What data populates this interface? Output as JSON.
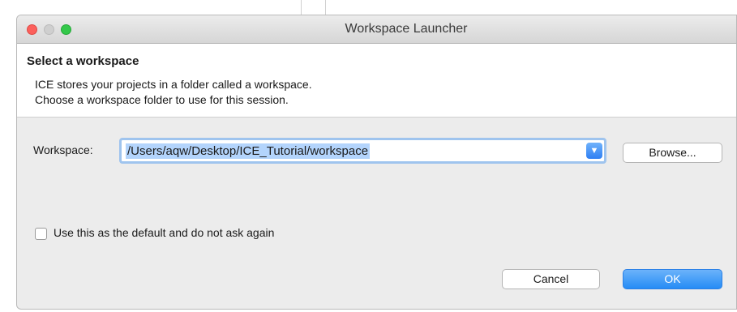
{
  "window": {
    "title": "Workspace Launcher"
  },
  "header": {
    "title": "Select a workspace",
    "description_line1": "ICE stores your projects in a folder called a workspace.",
    "description_line2": "Choose a workspace folder to use for this session."
  },
  "workspace": {
    "label": "Workspace:",
    "value": "/Users/aqw/Desktop/ICE_Tutorial/workspace",
    "browse_label": "Browse..."
  },
  "default_option": {
    "label": "Use this as the default and do not ask again",
    "checked": false
  },
  "buttons": {
    "cancel_label": "Cancel",
    "ok_label": "OK"
  },
  "colors": {
    "accent": "#2f7ff3",
    "selection": "#b3d4fc",
    "close": "#fc605c",
    "zoom": "#34c84a"
  }
}
